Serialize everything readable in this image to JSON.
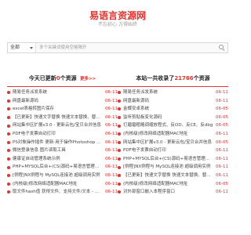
{
  "site": {
    "logo": "易语言资源网",
    "tagline": "不忘初心 方得始终"
  },
  "search": {
    "category": "全部",
    "placeholder": "多个关键词使用空格隔开"
  },
  "left": {
    "title": "今天已更新",
    "count": "0",
    "suffix": "个资源",
    "more": "更多>>",
    "items": [
      {
        "title": "随易任务派发系统",
        "date": "06-11"
      },
      {
        "title": "网盘最新源码",
        "date": "06-11"
      },
      {
        "title": "excel表格转图片保存",
        "date": "06-11"
      },
      {
        "title": "【已更新】快速文字替换 快速文本替换、替代通...",
        "date": "06-11"
      },
      {
        "title": "网站集中区扩展v3.0 - 更新云包/宝贝合并信息",
        "date": "06-11"
      },
      {
        "title": "PDF电子发票自动打印",
        "date": "06-11"
      },
      {
        "title": "PS对象操作插件 更新·用于操作Photoshop ...",
        "date": "06-11"
      },
      {
        "title": "微信登录信息 图片读取工具",
        "date": "06-11"
      },
      {
        "title": "健康证自动管理系统示例",
        "date": "06-11"
      },
      {
        "title": "PHP+MYSQL后台+(CS)源码+易语言管理例子",
        "date": "06-11"
      },
      {
        "title": "[例程]NX例程与 MySQL连接池 超级调用实例",
        "date": "06-11"
      },
      {
        "title": "(内核级)修改网络适配器MAC地址",
        "date": "06-11"
      },
      {
        "title": "取文件hash值 获得文件、支持文件/文本 - 长...",
        "date": "06-11"
      }
    ]
  },
  "right": {
    "title_prefix": "本站一共收录了",
    "count": "21766",
    "suffix": "个资源",
    "items": [
      {
        "title": "随易任务派发系统",
        "date": "06-11"
      },
      {
        "title": "网盘最新源码",
        "date": "06-11"
      },
      {
        "title": "金蝶安卓系统",
        "date": "06-05"
      },
      {
        "title": "监听剪贴板变化源码",
        "date": "06-05"
      },
      {
        "title": "打磨磨粗略调缩放程式、反OD、反CE、反dbg",
        "date": "06-05"
      },
      {
        "title": "(内核级)修改网络适配器MAC地址",
        "date": "06-11"
      },
      {
        "title": "网站集中区扩展v3.0 - 更新云包/宝贝合并信息",
        "date": "06-05"
      },
      {
        "title": "PDF电子发票自动打印",
        "date": "06-11"
      },
      {
        "title": "PHP+MYSQL后台+(CS)源码+易语言管理例子",
        "date": "06-11"
      },
      {
        "title": "[例程]NX例程与 MySQL连接池 超级调用实例",
        "date": "06-11"
      },
      {
        "title": "【已更新】快速文字替换 快速文本替换、替代通...",
        "date": "06-11"
      },
      {
        "title": "(内核级)修改网络适配器MAC地址",
        "date": "06-05"
      },
      {
        "title": "对外部窗口嵌入本程序窗口",
        "date": "06-11"
      }
    ]
  },
  "colors": {
    "accent": "#e0342f",
    "muted": "#9a9a9a"
  }
}
